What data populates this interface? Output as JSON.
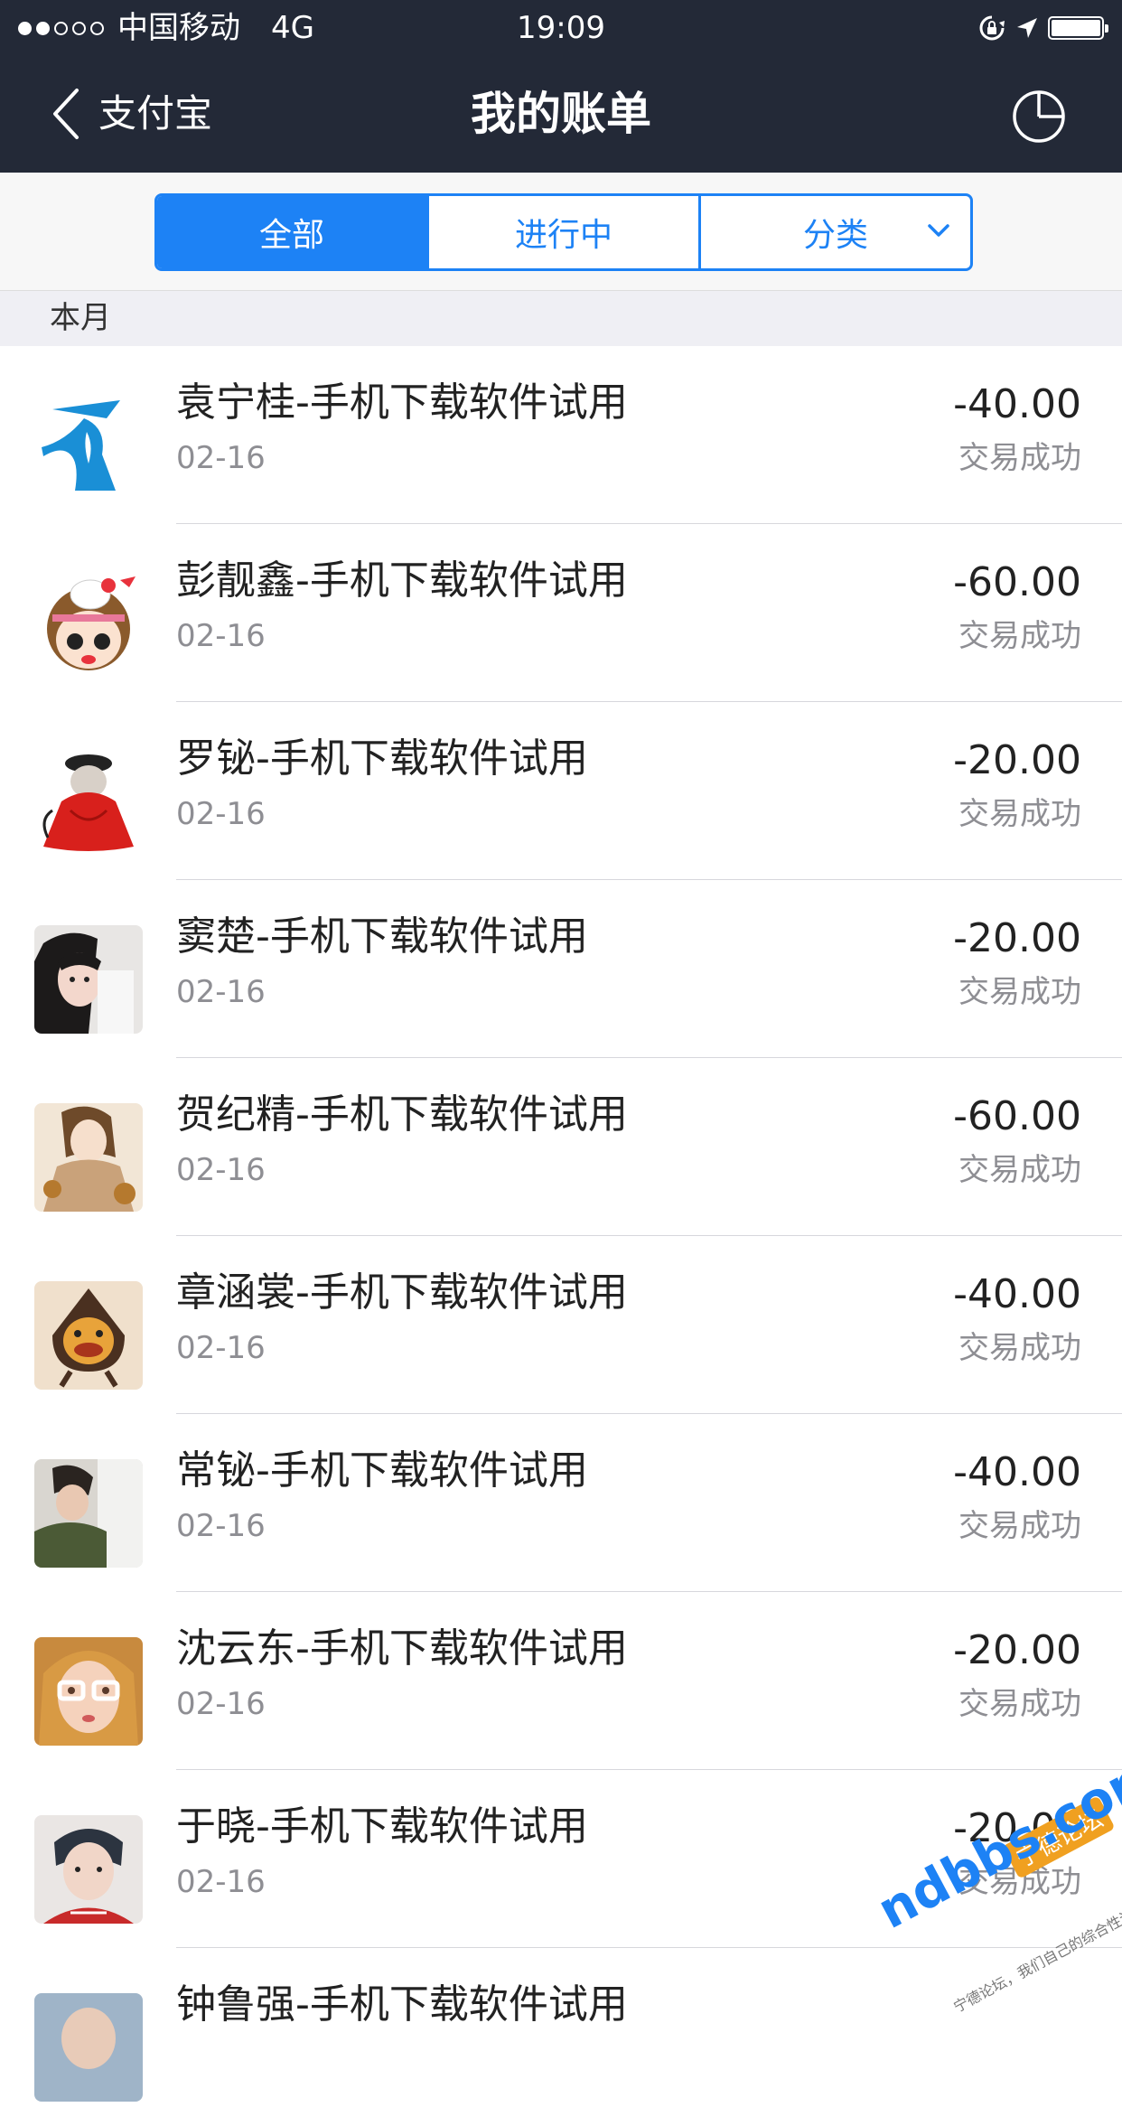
{
  "status_bar": {
    "carrier": "中国移动",
    "network": "4G",
    "time": "19:09",
    "signal_bars_filled": 2,
    "signal_bars_total": 5
  },
  "nav": {
    "back_label": "支付宝",
    "title": "我的账单"
  },
  "tabs": [
    {
      "label": "全部",
      "active": true
    },
    {
      "label": "进行中",
      "active": false
    },
    {
      "label": "分类",
      "active": false
    }
  ],
  "section": {
    "title": "本月"
  },
  "bills": [
    {
      "name": "袁宁桂-手机下载软件试用",
      "date": "02-16",
      "amount": "-40.00",
      "status": "交易成功"
    },
    {
      "name": "彭靓鑫-手机下载软件试用",
      "date": "02-16",
      "amount": "-60.00",
      "status": "交易成功"
    },
    {
      "name": "罗铋-手机下载软件试用",
      "date": "02-16",
      "amount": "-20.00",
      "status": "交易成功"
    },
    {
      "name": "窦楚-手机下载软件试用",
      "date": "02-16",
      "amount": "-20.00",
      "status": "交易成功"
    },
    {
      "name": "贺纪精-手机下载软件试用",
      "date": "02-16",
      "amount": "-60.00",
      "status": "交易成功"
    },
    {
      "name": "章涵裳-手机下载软件试用",
      "date": "02-16",
      "amount": "-40.00",
      "status": "交易成功"
    },
    {
      "name": "常铋-手机下载软件试用",
      "date": "02-16",
      "amount": "-40.00",
      "status": "交易成功"
    },
    {
      "name": "沈云东-手机下载软件试用",
      "date": "02-16",
      "amount": "-20.00",
      "status": "交易成功"
    },
    {
      "name": "于晓-手机下载软件试用",
      "date": "02-16",
      "amount": "-20.00",
      "status": "交易成功"
    },
    {
      "name": "钟鲁强-手机下载软件试用",
      "date": "",
      "amount": "",
      "status": ""
    }
  ],
  "watermark": {
    "logo": "ndbbs.com",
    "badge": "宁德论坛",
    "tagline": "宁德论坛，我们自己的综合性论坛"
  },
  "colors": {
    "header_bg": "#232937",
    "accent": "#1d82f5",
    "section_bg": "#efeff4",
    "secondary_text": "#8e8e93"
  },
  "icons": {
    "back": "chevron-left-icon",
    "chart": "pie-chart-icon",
    "category_dropdown": "chevron-down-icon",
    "status_lock": "rotation-lock-icon",
    "status_location": "location-arrow-icon",
    "status_battery": "battery-icon"
  }
}
